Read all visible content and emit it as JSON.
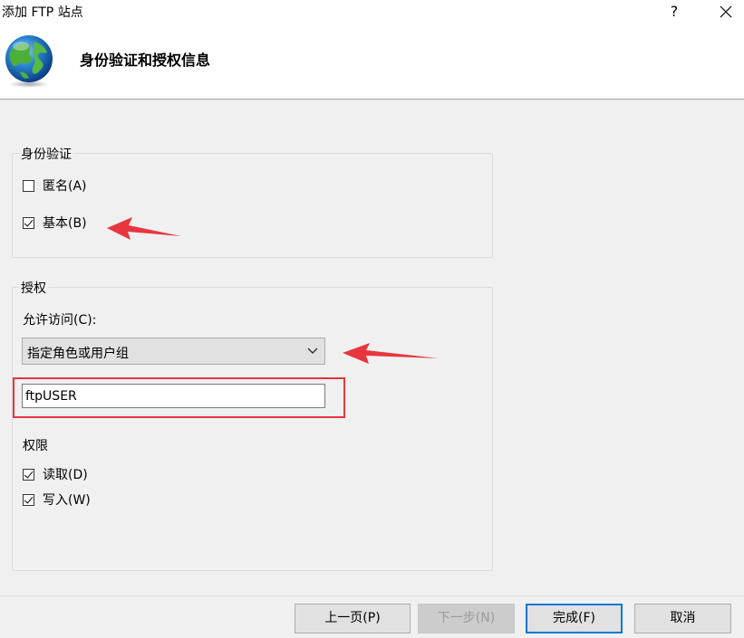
{
  "window": {
    "title": "添加 FTP 站点",
    "help_label": "?",
    "close_label": "✕"
  },
  "header": {
    "title": "身份验证和授权信息",
    "icon": "globe-icon"
  },
  "authentication": {
    "legend": "身份验证",
    "anonymous": {
      "label": "匿名(A)",
      "checked": false
    },
    "basic": {
      "label": "基本(B)",
      "checked": true
    }
  },
  "authorization": {
    "legend": "授权",
    "allow_access_label": "允许访问(C):",
    "allow_access_value": "指定角色或用户组",
    "users_value": "ftpUSER",
    "permissions_label": "权限",
    "read": {
      "label": "读取(D)",
      "checked": true
    },
    "write": {
      "label": "写入(W)",
      "checked": true
    }
  },
  "footer": {
    "prev_label": "上一页(P)",
    "next_label": "下一步(N)",
    "finish_label": "完成(F)",
    "cancel_label": "取消"
  },
  "colors": {
    "annotation_red": "#e8363e",
    "default_button_border": "#0078d7"
  }
}
